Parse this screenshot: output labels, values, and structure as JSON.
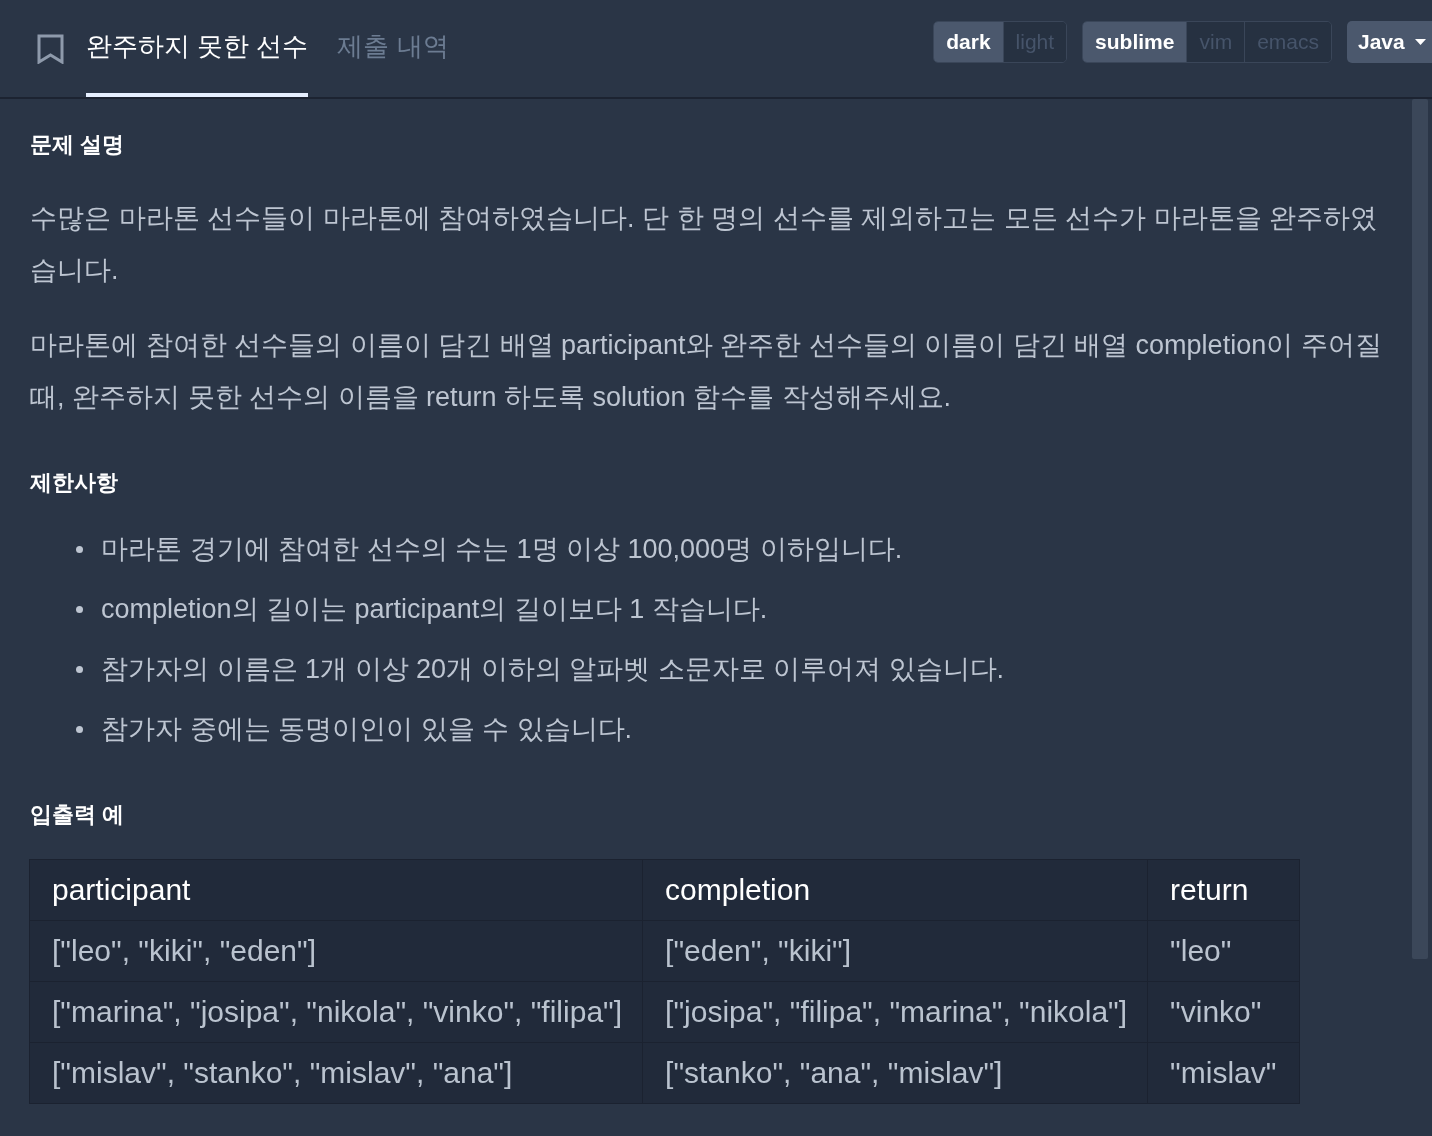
{
  "tabs": [
    {
      "label": "완주하지 못한 선수",
      "selected": true
    },
    {
      "label": "제출 내역",
      "selected": false
    }
  ],
  "toggle_groups": [
    {
      "options": [
        {
          "label": "dark",
          "selected": true
        },
        {
          "label": "light",
          "selected": false
        }
      ]
    },
    {
      "options": [
        {
          "label": "sublime",
          "selected": true
        },
        {
          "label": "vim",
          "selected": false
        },
        {
          "label": "emacs",
          "selected": false
        }
      ]
    }
  ],
  "language_dropdown": {
    "value": "Java"
  },
  "sections": [
    {
      "kind": "paragraphs",
      "heading": "문제 설명",
      "paragraphs": [
        "수많은 마라톤 선수들이 마라톤에 참여하였습니다. 단 한 명의 선수를 제외하고는 모든 선수가 마라톤을 완주하였습니다.",
        "마라톤에 참여한 선수들의 이름이 담긴 배열 participant와 완주한 선수들의 이름이 담긴 배열 completion이 주어질 때, 완주하지 못한 선수의 이름을 return 하도록 solution 함수를 작성해주세요."
      ]
    },
    {
      "kind": "bullets",
      "heading": "제한사항",
      "items": [
        "마라톤 경기에 참여한 선수의 수는 1명 이상 100,000명 이하입니다.",
        "completion의 길이는 participant의 길이보다 1 작습니다.",
        "참가자의 이름은 1개 이상 20개 이하의 알파벳 소문자로 이루어져 있습니다.",
        "참가자 중에는 동명이인이 있을 수 있습니다."
      ]
    },
    {
      "kind": "table",
      "heading": "입출력 예",
      "table": {
        "columns": [
          "participant",
          "completion",
          "return"
        ],
        "rows": [
          [
            "[\"leo\", \"kiki\", \"eden\"]",
            "[\"eden\", \"kiki\"]",
            "\"leo\""
          ],
          [
            "[\"marina\", \"josipa\", \"nikola\", \"vinko\", \"filipa\"]",
            "[\"josipa\", \"filipa\", \"marina\", \"nikola\"]",
            "\"vinko\""
          ],
          [
            "[\"mislav\", \"stanko\", \"mislav\", \"ana\"]",
            "[\"stanko\", \"ana\", \"mislav\"]",
            "\"mislav\""
          ]
        ]
      }
    }
  ]
}
